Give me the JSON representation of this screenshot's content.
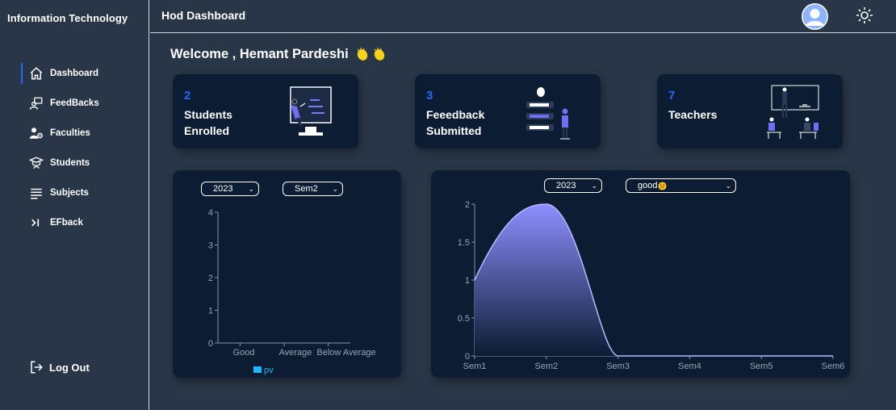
{
  "sidebar": {
    "brand": "Information Technology",
    "items": [
      {
        "label": "Dashboard",
        "icon": "home-icon",
        "active": true
      },
      {
        "label": "FeedBacks",
        "icon": "feedback-person-icon"
      },
      {
        "label": "Faculties",
        "icon": "faculty-gear-icon"
      },
      {
        "label": "Students",
        "icon": "student-cap-icon"
      },
      {
        "label": "Subjects",
        "icon": "list-lines-icon"
      },
      {
        "label": "EFback",
        "icon": "chevron-bar-icon"
      }
    ],
    "logout_label": "Log Out"
  },
  "header": {
    "title": "Hod Dashboard"
  },
  "welcome": {
    "text": "Welcome , Hemant Pardeshi"
  },
  "cards": [
    {
      "count": "2",
      "label": "Students Enrolled"
    },
    {
      "count": "3",
      "label": "Feeedback Submitted"
    },
    {
      "count": "7",
      "label": "Teachers"
    }
  ],
  "left_panel": {
    "year_select": "2023",
    "sem_select": "Sem2"
  },
  "right_panel": {
    "year_select": "2023",
    "rating_select": "good"
  },
  "colors": {
    "accent": "#1f6bff",
    "panel": "#0c1c32",
    "background": "#283647",
    "legend_pv": "#1fb6ff",
    "area_top": "#8e8eff",
    "area_line": "#b9b9ff"
  },
  "chart_data": [
    {
      "type": "bar",
      "categories": [
        "Good",
        "Average",
        "Below Average"
      ],
      "series": [
        {
          "name": "pv",
          "values": [
            0,
            0,
            0
          ]
        }
      ],
      "ylim": [
        0,
        4
      ],
      "yticks": [
        0,
        1,
        2,
        3,
        4
      ],
      "legend": "bottom",
      "grid": false
    },
    {
      "type": "area",
      "categories": [
        "Sem1",
        "Sem2",
        "Sem3",
        "Sem4",
        "Sem5",
        "Sem6"
      ],
      "series": [
        {
          "values": [
            1,
            2,
            0,
            0,
            0,
            0
          ]
        }
      ],
      "ylim": [
        0,
        2
      ],
      "yticks": [
        "0",
        "0.5",
        "1",
        "1.5",
        "2"
      ],
      "grid": false
    }
  ]
}
